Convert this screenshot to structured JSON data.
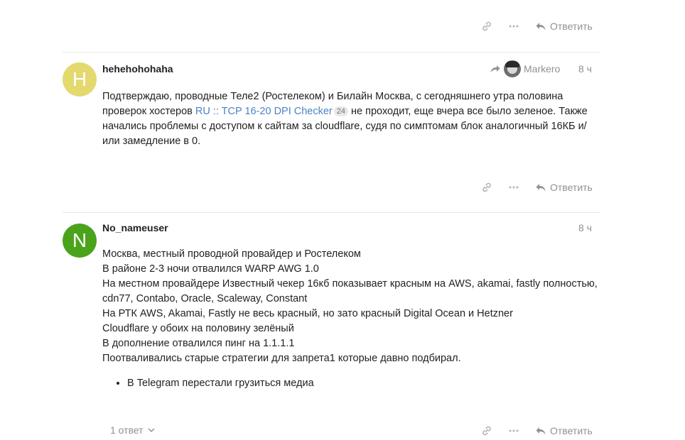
{
  "actions": {
    "reply_label": "Ответить"
  },
  "posts": [
    {
      "avatar_letter": "H",
      "avatar_color": "#e3d96f",
      "username": "hehehohohaha",
      "reply_to_user": "Markero",
      "time": "8 ч",
      "text_1": "Подтверждаю, проводные Теле2 (Ростелеком) и Билайн Москва, с сегодняшнего утра половина проверок хостеров ",
      "link_text": "RU :: TCP 16-20 DPI Checker",
      "link_count": "24",
      "text_2": " не проходит, еще вчера все было зеленое. Также начались проблемы с доступом к сайтам за cloudflare, судя по симптомам блок аналогичный 16КБ и/или замедление в 0."
    },
    {
      "avatar_letter": "N",
      "avatar_color": "#4ba31c",
      "username": "No_nameuser",
      "time": "8 ч",
      "lines": [
        "Москва, местный проводной провайдер и Ростелеком",
        "В районе 2-3 ночи отвалился WARP AWG 1.0",
        "На местном провайдере Известный чекер 16кб показывает красным на AWS, akamai, fastly полностью, cdn77, Contabo, Oracle, Scaleway, Constant",
        "На РТК AWS, Akamai, Fastly не весь красный, но зато красный Digital Ocean и Hetzner",
        "Cloudflare у обоих на половину зелёный",
        "В дополнение отвалился пинг на 1.1.1.1",
        "Поотваливались старые стратегии для запрета1 которые давно подбирал."
      ],
      "list_items": [
        "В Telegram перестали грузиться медиа"
      ],
      "replies_toggle": "1 ответ"
    }
  ]
}
